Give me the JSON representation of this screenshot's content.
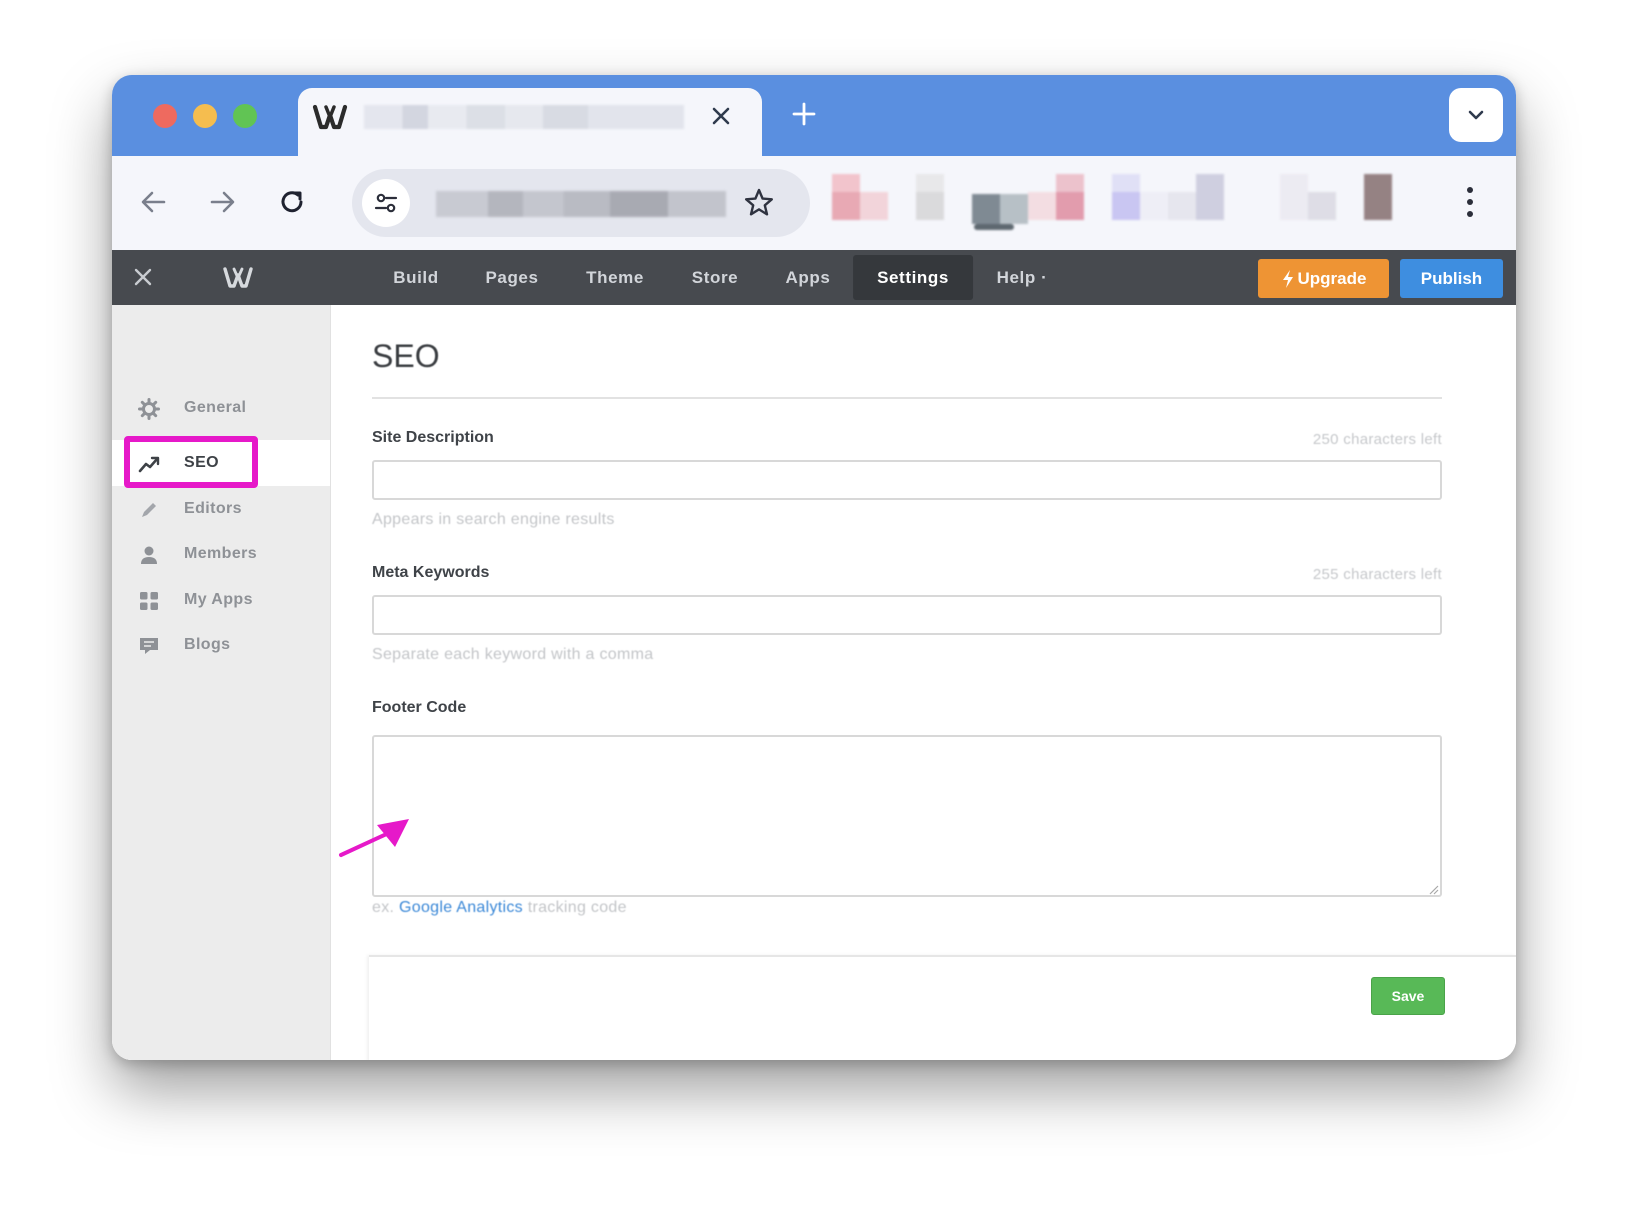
{
  "browser": {
    "tab": {
      "title": "",
      "close_icon": "close-icon",
      "favicon": "weebly-logo"
    },
    "address_bar": {
      "url": ""
    },
    "colors": {
      "tabstrip": "#5a8fe0",
      "toolbar": "#f5f6fb"
    }
  },
  "app_bar": {
    "nav": [
      {
        "label": "Build"
      },
      {
        "label": "Pages"
      },
      {
        "label": "Theme"
      },
      {
        "label": "Store"
      },
      {
        "label": "Apps"
      },
      {
        "label": "Settings",
        "active": true
      },
      {
        "label": "Help ·"
      }
    ],
    "upgrade_label": "Upgrade",
    "publish_label": "Publish",
    "colors": {
      "bar": "#474a4f",
      "upgrade": "#ee9434",
      "publish": "#3e8ee0"
    }
  },
  "sidebar": {
    "items": [
      {
        "label": "General",
        "icon": "gear-icon"
      },
      {
        "label": "SEO",
        "icon": "trend-icon",
        "active": true
      },
      {
        "label": "Editors",
        "icon": "pencil-icon"
      },
      {
        "label": "Members",
        "icon": "person-icon"
      },
      {
        "label": "My Apps",
        "icon": "grid-icon"
      },
      {
        "label": "Blogs",
        "icon": "chat-icon"
      }
    ],
    "highlight_color": "#e619c9"
  },
  "main": {
    "title": "SEO",
    "fields": {
      "site_description": {
        "label": "Site Description",
        "counter": "250 characters left",
        "value": "",
        "help": "Appears in search engine results"
      },
      "meta_keywords": {
        "label": "Meta Keywords",
        "counter": "255 characters left",
        "value": "",
        "help": "Separate each keyword with a comma"
      },
      "footer_code": {
        "label": "Footer Code",
        "value": "",
        "help_prefix": "ex.",
        "help_link": "Google Analytics",
        "help_suffix": "tracking code"
      }
    },
    "save_label": "Save",
    "save_color": "#58b957"
  }
}
